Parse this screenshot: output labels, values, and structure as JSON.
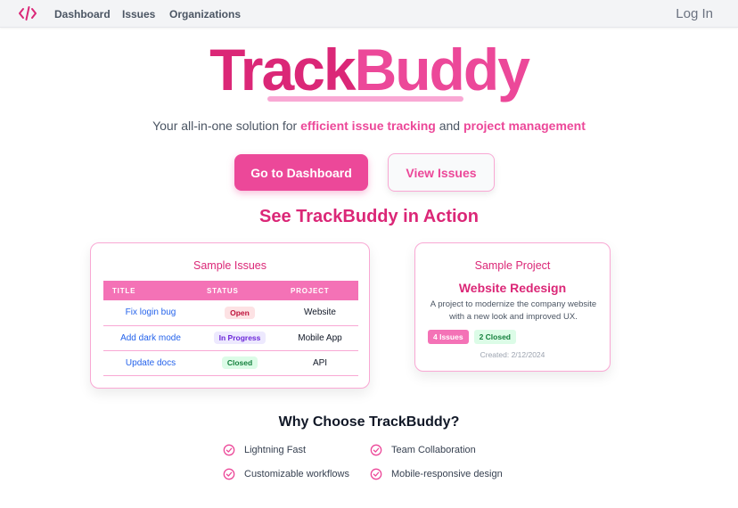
{
  "nav": {
    "logo_icon": "code-icon",
    "links": [
      "Dashboard",
      "Issues",
      "Organizations"
    ],
    "login": "Log In"
  },
  "hero": {
    "title_part1": "Track",
    "title_part2": "Buddy",
    "tagline": {
      "pre": "Your all-in-one solution for ",
      "highlight1": "efficient issue tracking",
      "mid": " and ",
      "highlight2": "project management"
    },
    "primary_button": "Go to Dashboard",
    "secondary_button": "View Issues"
  },
  "demo": {
    "title": "See TrackBuddy in Action",
    "issues_card": {
      "title": "Sample Issues",
      "headers": [
        "TITLE",
        "STATUS",
        "PROJECT"
      ],
      "rows": [
        {
          "title": "Fix login bug",
          "status": "Open",
          "project": "Website"
        },
        {
          "title": "Add dark mode",
          "status": "In Progress",
          "project": "Mobile App"
        },
        {
          "title": "Update docs",
          "status": "Closed",
          "project": "API"
        }
      ]
    },
    "project_card": {
      "title": "Sample Project",
      "name": "Website Redesign",
      "description": "A project to modernize the company website with a new look and improved UX.",
      "badge_issues": "4 Issues",
      "badge_closed": "2 Closed",
      "created": "Created: 2/12/2024"
    }
  },
  "why": {
    "title": "Why Choose TrackBuddy?",
    "features": [
      "Lightning Fast",
      "Team Collaboration",
      "Customizable workflows",
      "Mobile-responsive design"
    ],
    "feature_icon": "check-circle-icon"
  },
  "colors": {
    "brand": "#db2777",
    "accent": "#ec4899",
    "accent_light": "#f9a8d4"
  }
}
